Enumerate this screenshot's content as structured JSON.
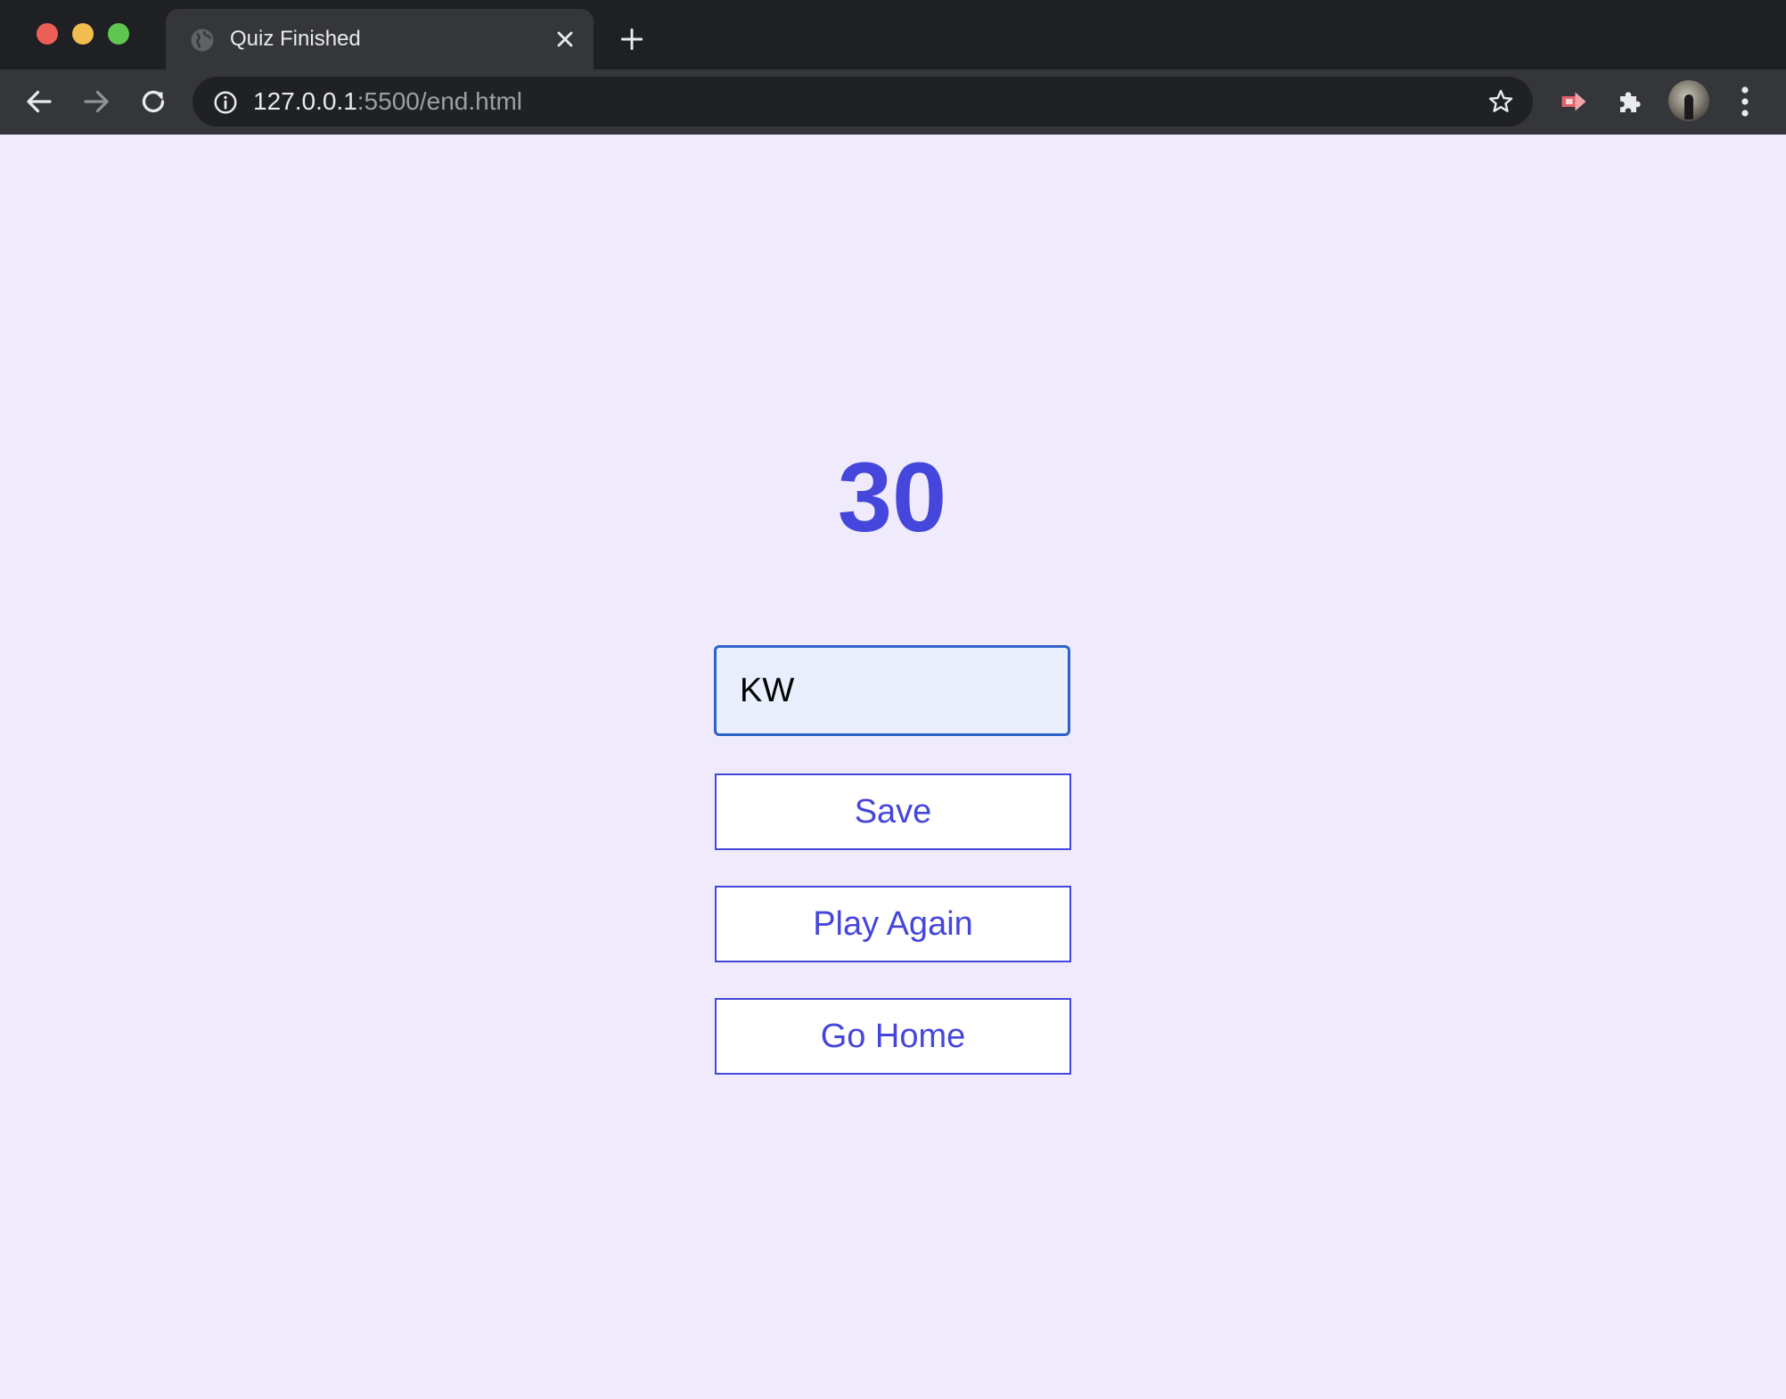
{
  "browser": {
    "tab": {
      "title": "Quiz Finished"
    },
    "address_bar": {
      "url_host": "127.0.0.1",
      "url_rest": ":5500/end.html"
    },
    "icons": {
      "favicon": "globe-icon",
      "close": "close-icon",
      "new_tab": "plus-icon",
      "back": "arrow-left-icon",
      "forward": "arrow-right-icon",
      "reload": "reload-icon",
      "info": "info-icon",
      "bookmark": "star-icon",
      "extension_1": "red-arrow-extension-icon",
      "extensions": "puzzle-icon",
      "menu": "vertical-dots-icon"
    }
  },
  "page": {
    "score": "30",
    "username_input": {
      "value": "KW"
    },
    "buttons": {
      "save": "Save",
      "play_again": "Play Again",
      "go_home": "Go Home"
    }
  },
  "colors": {
    "background": "#efebfc",
    "accent": "#4546db",
    "input_border": "#2d62c8",
    "input_background": "#e9effd"
  }
}
